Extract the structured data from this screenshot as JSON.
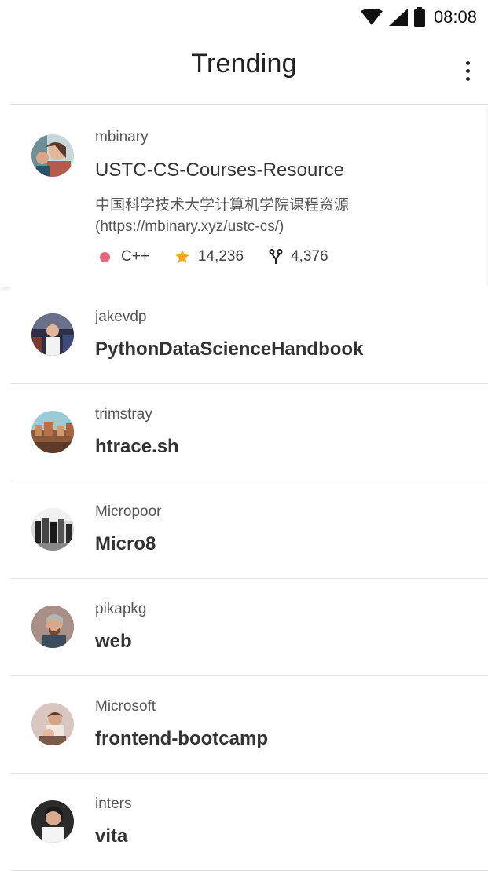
{
  "status_bar": {
    "time": "08:08"
  },
  "app_bar": {
    "title": "Trending"
  },
  "featured": {
    "owner": "mbinary",
    "repo": "USTC-CS-Courses-Resource",
    "description": "中国科学技术大学计算机学院课程资源(https://mbinary.xyz/ustc-cs/)",
    "language": "C++",
    "language_color": "#e8667a",
    "stars": "14,236",
    "forks": "4,376",
    "star_color": "#f5a623"
  },
  "repos": [
    {
      "owner": "jakevdp",
      "repo": "PythonDataScienceHandbook"
    },
    {
      "owner": "trimstray",
      "repo": "htrace.sh"
    },
    {
      "owner": "Micropoor",
      "repo": "Micro8"
    },
    {
      "owner": "pikapkg",
      "repo": "web"
    },
    {
      "owner": "Microsoft",
      "repo": "frontend-bootcamp"
    },
    {
      "owner": "inters",
      "repo": "vita"
    }
  ]
}
